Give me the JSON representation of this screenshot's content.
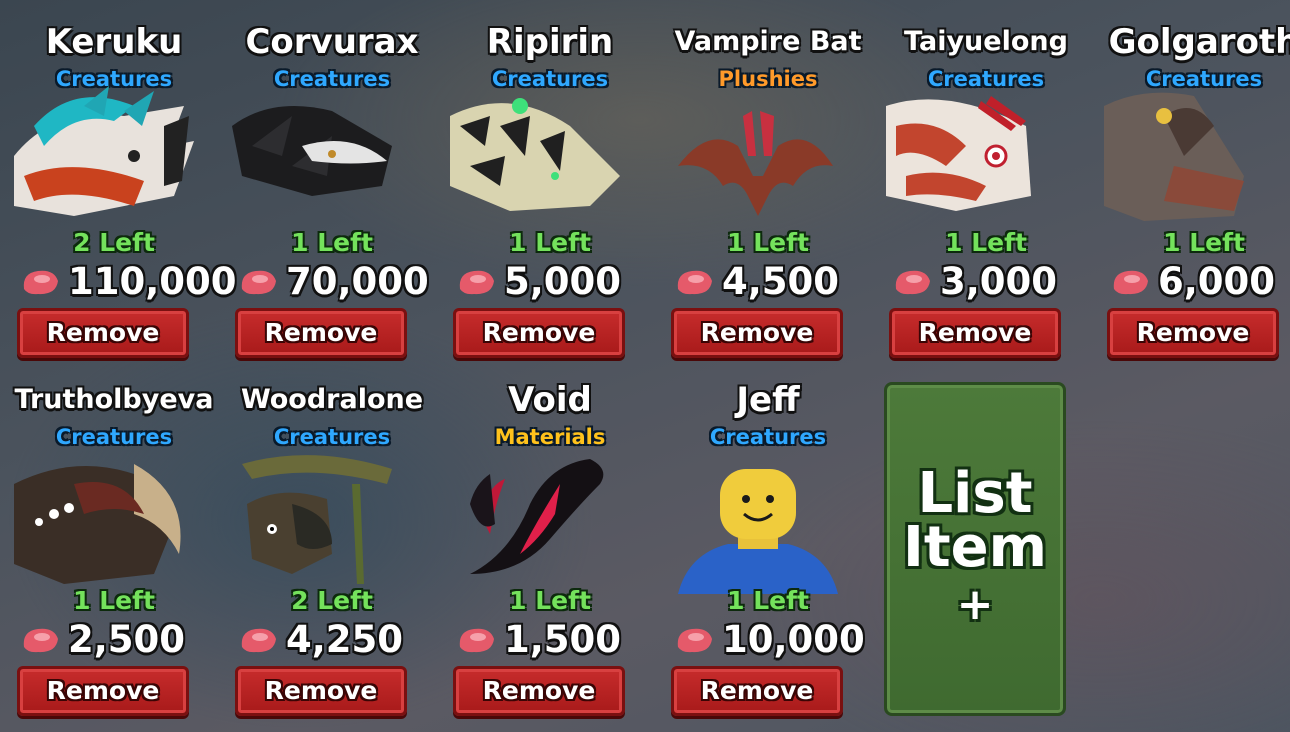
{
  "items": [
    {
      "name": "Keruku",
      "category": "Creatures",
      "left": "2 Left",
      "price": "110,000",
      "remove": "Remove"
    },
    {
      "name": "Corvurax",
      "category": "Creatures",
      "left": "1 Left",
      "price": "70,000",
      "remove": "Remove"
    },
    {
      "name": "Ripirin",
      "category": "Creatures",
      "left": "1 Left",
      "price": "5,000",
      "remove": "Remove"
    },
    {
      "name": "Vampire Bat",
      "category": "Plushies",
      "left": "1 Left",
      "price": "4,500",
      "remove": "Remove"
    },
    {
      "name": "Taiyuelong",
      "category": "Creatures",
      "left": "1 Left",
      "price": "3,000",
      "remove": "Remove"
    },
    {
      "name": "Golgaroth",
      "category": "Creatures",
      "left": "1 Left",
      "price": "6,000",
      "remove": "Remove"
    },
    {
      "name": "Trutholbyeva",
      "category": "Creatures",
      "left": "1 Left",
      "price": "2,500",
      "remove": "Remove"
    },
    {
      "name": "Woodralone",
      "category": "Creatures",
      "left": "2 Left",
      "price": "4,250",
      "remove": "Remove"
    },
    {
      "name": "Void",
      "category": "Materials",
      "left": "1 Left",
      "price": "1,500",
      "remove": "Remove"
    },
    {
      "name": "Jeff",
      "category": "Creatures",
      "left": "1 Left",
      "price": "10,000",
      "remove": "Remove"
    }
  ],
  "list_button": {
    "line1": "List",
    "line2": "Item",
    "plus": "+"
  },
  "colors": {
    "creatures": "#2fa8ff",
    "plushies": "#ff9a2a",
    "materials": "#ffc21c",
    "left": "#74e25c",
    "remove": "#c72c2c",
    "list": "#4d7a3a"
  },
  "icons": {
    "price": "meat-icon"
  }
}
